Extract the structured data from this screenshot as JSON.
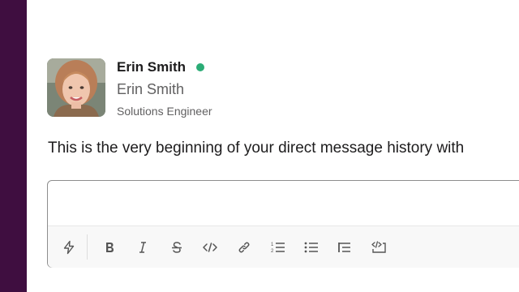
{
  "profile": {
    "display_name": "Erin Smith",
    "full_name": "Erin Smith",
    "title": "Solutions Engineer",
    "status": "active",
    "status_color": "#2bac76"
  },
  "history_text": "This is the very beginning of your direct message history with",
  "composer": {
    "placeholder": "",
    "toolbar": [
      "shortcuts-icon",
      "bold-icon",
      "italic-icon",
      "strikethrough-icon",
      "code-icon",
      "link-icon",
      "ordered-list-icon",
      "bulleted-list-icon",
      "blockquote-icon",
      "code-block-icon"
    ]
  },
  "colors": {
    "sidebar": "#3f0e40",
    "text": "#1d1c1d",
    "muted": "#616061"
  }
}
